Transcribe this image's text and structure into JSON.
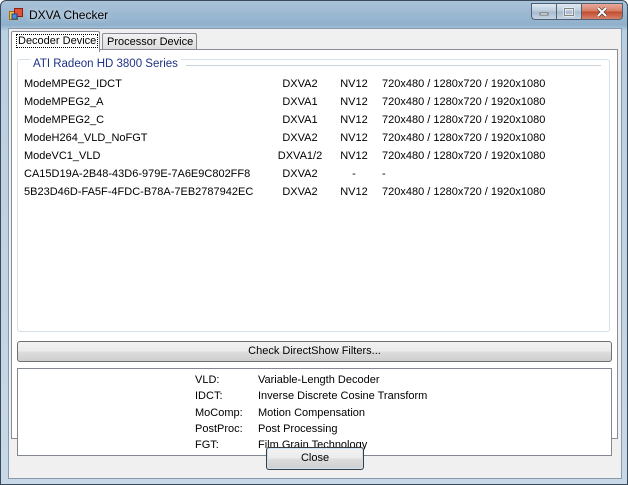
{
  "window": {
    "title": "DXVA Checker"
  },
  "tabs": [
    {
      "label": "Decoder Device",
      "active": true
    },
    {
      "label": "Processor Device",
      "active": false
    }
  ],
  "group": {
    "title": "ATI Radeon HD 3800 Series",
    "decoders": [
      {
        "name": "ModeMPEG2_IDCT",
        "api": "DXVA2",
        "format": "NV12",
        "resolutions": "720x480 / 1280x720 / 1920x1080"
      },
      {
        "name": "ModeMPEG2_A",
        "api": "DXVA1",
        "format": "NV12",
        "resolutions": "720x480 / 1280x720 / 1920x1080"
      },
      {
        "name": "ModeMPEG2_C",
        "api": "DXVA1",
        "format": "NV12",
        "resolutions": "720x480 / 1280x720 / 1920x1080"
      },
      {
        "name": "ModeH264_VLD_NoFGT",
        "api": "DXVA2",
        "format": "NV12",
        "resolutions": "720x480 / 1280x720 / 1920x1080"
      },
      {
        "name": "ModeVC1_VLD",
        "api": "DXVA1/2",
        "format": "NV12",
        "resolutions": "720x480 / 1280x720 / 1920x1080"
      },
      {
        "name": "CA15D19A-2B48-43D6-979E-7A6E9C802FF8",
        "api": "DXVA2",
        "format": "-",
        "resolutions": "-"
      },
      {
        "name": "5B23D46D-FA5F-4FDC-B78A-7EB2787942EC",
        "api": "DXVA2",
        "format": "NV12",
        "resolutions": "720x480 / 1280x720 / 1920x1080"
      }
    ]
  },
  "buttons": {
    "check_filters": "Check DirectShow Filters...",
    "close": "Close"
  },
  "glossary": [
    {
      "abbr": "VLD:",
      "definition": "Variable-Length Decoder"
    },
    {
      "abbr": "IDCT:",
      "definition": "Inverse Discrete Cosine Transform"
    },
    {
      "abbr": "MoComp:",
      "definition": "Motion Compensation"
    },
    {
      "abbr": "PostProc:",
      "definition": "Post Processing"
    },
    {
      "abbr": "FGT:",
      "definition": "Film Grain Technology"
    }
  ],
  "colors": {
    "group_title": "#1e3287",
    "close_button_red": "#c04a2c"
  },
  "icons": {
    "app": "app-window-icon",
    "minimize": "minimize-icon",
    "maximize": "maximize-icon",
    "close": "close-icon"
  }
}
